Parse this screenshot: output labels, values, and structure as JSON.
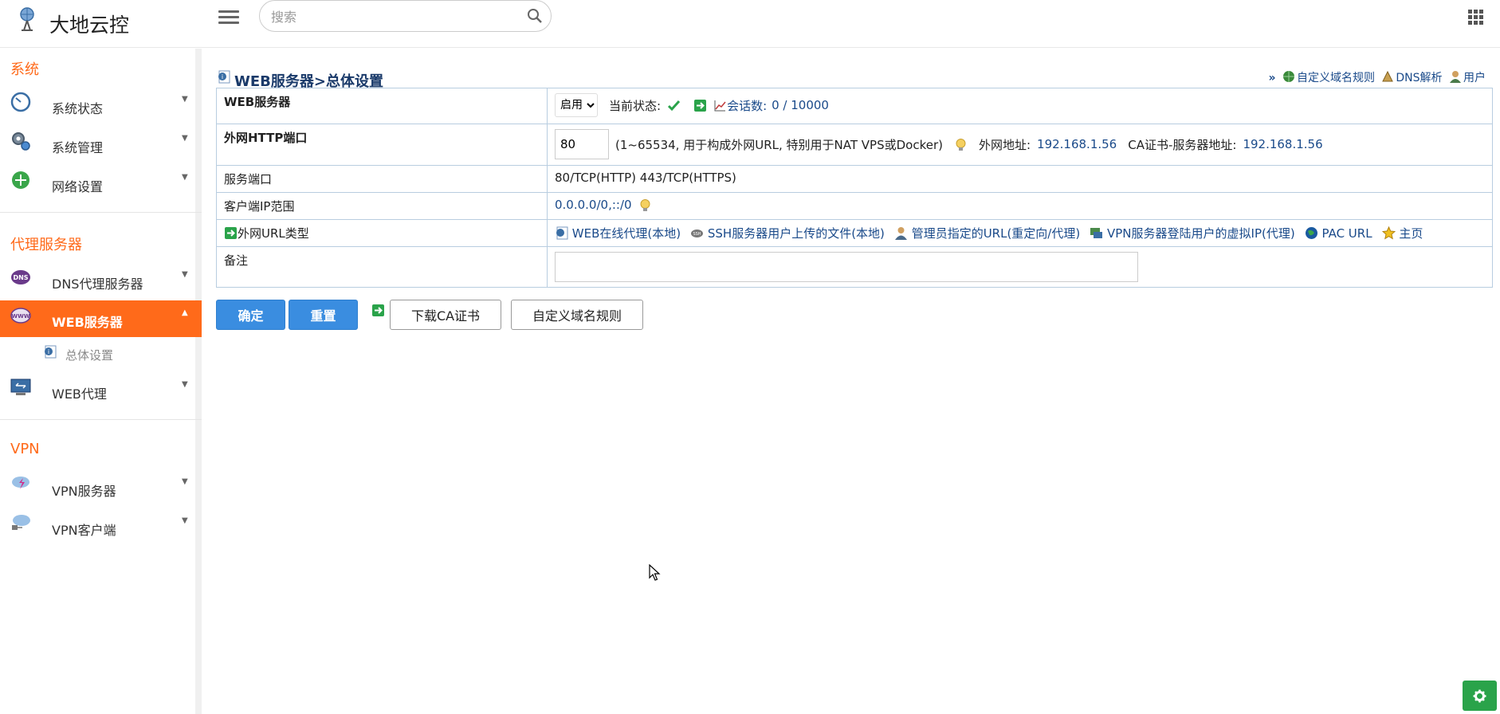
{
  "app": {
    "title": "大地云控"
  },
  "search": {
    "placeholder": "搜索"
  },
  "sidebar": {
    "sections": [
      {
        "title": "系统",
        "items": [
          {
            "label": "系统状态"
          },
          {
            "label": "系统管理"
          },
          {
            "label": "网络设置"
          }
        ]
      },
      {
        "title": "代理服务器",
        "items": [
          {
            "label": "DNS代理服务器"
          },
          {
            "label": "WEB服务器"
          },
          {
            "label": "WEB代理"
          }
        ],
        "sub": [
          {
            "label": "总体设置"
          }
        ]
      },
      {
        "title": "VPN",
        "items": [
          {
            "label": "VPN服务器"
          },
          {
            "label": "VPN客户端"
          }
        ]
      }
    ]
  },
  "main": {
    "title": "WEB服务器>总体设置",
    "toplinks": {
      "prefix": "»",
      "custom_domain": "自定义域名规则",
      "dns": "DNS解析",
      "user": "用户"
    },
    "rows": {
      "web_server": {
        "label": "WEB服务器",
        "select_value": "启用",
        "status_label": "当前状态:",
        "sessions_label": "会话数:",
        "sessions_value": "0 / 10000"
      },
      "http_port": {
        "label": "外网HTTP端口",
        "value": "80",
        "hint": "(1~65534, 用于构成外网URL, 特别用于NAT VPS或Docker)",
        "external_label": "外网地址:",
        "external_value": "192.168.1.56",
        "ca_label": "CA证书-服务器地址:",
        "ca_value": "192.168.1.56"
      },
      "service_port": {
        "label": "服务端口",
        "value": "80/TCP(HTTP) 443/TCP(HTTPS)"
      },
      "client_ip": {
        "label": "客户端IP范围",
        "value": "0.0.0.0/0,::/0"
      },
      "url_type": {
        "label": "外网URL类型",
        "links": [
          "WEB在线代理(本地)",
          "SSH服务器用户上传的文件(本地)",
          "管理员指定的URL(重定向/代理)",
          "VPN服务器登陆用户的虚拟IP(代理)",
          "PAC URL",
          "主页"
        ]
      },
      "remark": {
        "label": "备注",
        "value": ""
      }
    },
    "buttons": {
      "confirm": "确定",
      "reset": "重置",
      "download_ca": "下载CA证书",
      "custom_domain": "自定义域名规则"
    }
  },
  "colors": {
    "accent": "#ff6a1a",
    "primary_button": "#3a8de0",
    "link": "#1a4a8a",
    "fab": "#2aa34a"
  },
  "icons": [
    "logo-icon",
    "menu-icon",
    "search-icon",
    "apps-grid-icon",
    "gauge-icon",
    "gears-icon",
    "network-icon",
    "dns-icon",
    "www-icon",
    "web-proxy-icon",
    "vpn-server-icon",
    "vpn-client-icon",
    "check-icon",
    "arrow-icon",
    "chart-icon",
    "bulb-icon",
    "ssh-icon",
    "admin-icon",
    "vpn-icon",
    "globe-icon",
    "star-icon",
    "gear-icon"
  ]
}
